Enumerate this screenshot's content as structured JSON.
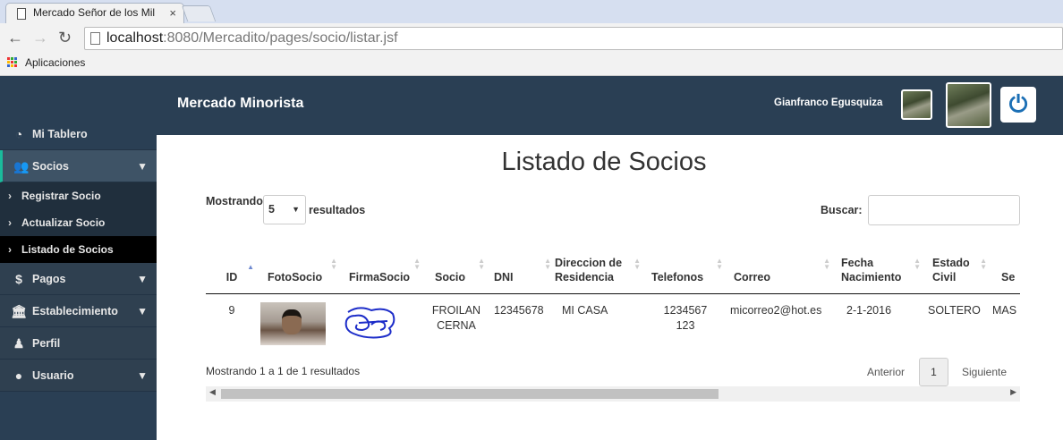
{
  "browser": {
    "tab_title": "Mercado Señor de los Mil",
    "url_host": "localhost",
    "url_rest": ":8080/Mercadito/pages/socio/listar.jsf",
    "bookmark_label": "Aplicaciones"
  },
  "header": {
    "brand": "Mercado Minorista",
    "user_name": "Gianfranco Egusquiza"
  },
  "sidebar": {
    "items": [
      {
        "label": "Mi Tablero",
        "icon": "dashboard-icon"
      },
      {
        "label": "Socios",
        "icon": "users-icon"
      },
      {
        "label": "Pagos",
        "icon": "dollar-icon"
      },
      {
        "label": "Establecimiento",
        "icon": "bank-icon"
      },
      {
        "label": "Perfil",
        "icon": "profile-icon"
      },
      {
        "label": "Usuario",
        "icon": "user-icon"
      }
    ],
    "socios_sub": [
      "Registrar Socio",
      "Actualizar Socio",
      "Listado de Socios"
    ]
  },
  "page": {
    "title": "Listado de Socios",
    "showing_prefix": "Mostrando",
    "page_size": "5",
    "showing_suffix": "resultados",
    "search_label": "Buscar:",
    "search_value": "",
    "footer_info": "Mostrando 1 a 1 de 1 resultados",
    "prev": "Anterior",
    "current_page": "1",
    "next": "Siguiente"
  },
  "table": {
    "columns": [
      "ID",
      "FotoSocio",
      "FirmaSocio",
      "Socio",
      "DNI",
      "Direccion de Residencia",
      "Telefonos",
      "Correo",
      "Fecha Nacimiento",
      "Estado Civil",
      "Se"
    ],
    "rows": [
      {
        "id": "9",
        "socio_line1": "FROILAN",
        "socio_line2": "CERNA",
        "dni": "12345678",
        "direccion": "MI CASA",
        "tel_line1": "1234567",
        "tel_line2": "123",
        "correo": "micorreo2@hot.es",
        "fecha": "2-1-2016",
        "estado": "SOLTERO",
        "sexo": "MAS"
      }
    ]
  },
  "colors": {
    "sidebar_bg": "#2a3f54",
    "active_accent": "#1abb9c",
    "power_icon": "#1b6fb5"
  }
}
